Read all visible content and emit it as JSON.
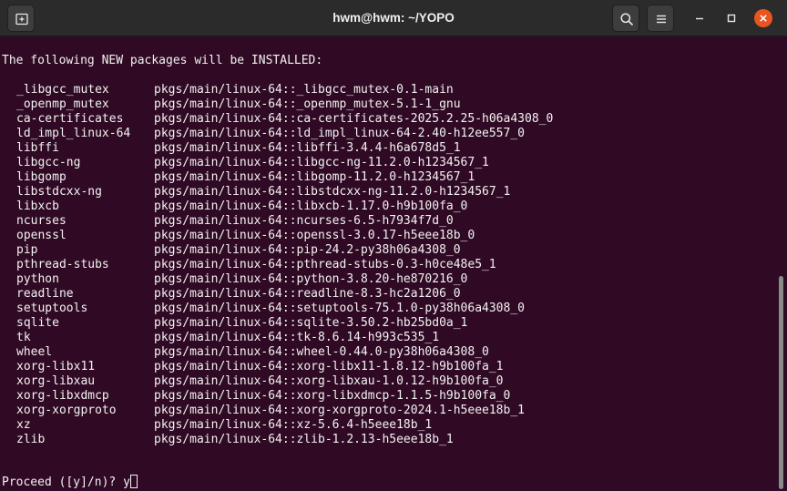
{
  "window": {
    "title": "hwm@hwm: ~/YOPO",
    "icons": {
      "new_tab": "new-tab-icon",
      "search": "search-icon",
      "menu": "hamburger-menu-icon",
      "minimize": "minimize-icon",
      "maximize": "maximize-icon",
      "close": "close-icon"
    },
    "colors": {
      "background": "#300a24",
      "titlebar": "#2b2b2b",
      "close": "#e95420",
      "text": "#f2f2f2"
    }
  },
  "terminal": {
    "header": "The following NEW packages will be INSTALLED:",
    "packages": [
      {
        "name": "_libgcc_mutex",
        "spec": "pkgs/main/linux-64::_libgcc_mutex-0.1-main"
      },
      {
        "name": "_openmp_mutex",
        "spec": "pkgs/main/linux-64::_openmp_mutex-5.1-1_gnu"
      },
      {
        "name": "ca-certificates",
        "spec": "pkgs/main/linux-64::ca-certificates-2025.2.25-h06a4308_0"
      },
      {
        "name": "ld_impl_linux-64",
        "spec": "pkgs/main/linux-64::ld_impl_linux-64-2.40-h12ee557_0"
      },
      {
        "name": "libffi",
        "spec": "pkgs/main/linux-64::libffi-3.4.4-h6a678d5_1"
      },
      {
        "name": "libgcc-ng",
        "spec": "pkgs/main/linux-64::libgcc-ng-11.2.0-h1234567_1"
      },
      {
        "name": "libgomp",
        "spec": "pkgs/main/linux-64::libgomp-11.2.0-h1234567_1"
      },
      {
        "name": "libstdcxx-ng",
        "spec": "pkgs/main/linux-64::libstdcxx-ng-11.2.0-h1234567_1"
      },
      {
        "name": "libxcb",
        "spec": "pkgs/main/linux-64::libxcb-1.17.0-h9b100fa_0"
      },
      {
        "name": "ncurses",
        "spec": "pkgs/main/linux-64::ncurses-6.5-h7934f7d_0"
      },
      {
        "name": "openssl",
        "spec": "pkgs/main/linux-64::openssl-3.0.17-h5eee18b_0"
      },
      {
        "name": "pip",
        "spec": "pkgs/main/linux-64::pip-24.2-py38h06a4308_0"
      },
      {
        "name": "pthread-stubs",
        "spec": "pkgs/main/linux-64::pthread-stubs-0.3-h0ce48e5_1"
      },
      {
        "name": "python",
        "spec": "pkgs/main/linux-64::python-3.8.20-he870216_0"
      },
      {
        "name": "readline",
        "spec": "pkgs/main/linux-64::readline-8.3-hc2a1206_0"
      },
      {
        "name": "setuptools",
        "spec": "pkgs/main/linux-64::setuptools-75.1.0-py38h06a4308_0"
      },
      {
        "name": "sqlite",
        "spec": "pkgs/main/linux-64::sqlite-3.50.2-hb25bd0a_1"
      },
      {
        "name": "tk",
        "spec": "pkgs/main/linux-64::tk-8.6.14-h993c535_1"
      },
      {
        "name": "wheel",
        "spec": "pkgs/main/linux-64::wheel-0.44.0-py38h06a4308_0"
      },
      {
        "name": "xorg-libx11",
        "spec": "pkgs/main/linux-64::xorg-libx11-1.8.12-h9b100fa_1"
      },
      {
        "name": "xorg-libxau",
        "spec": "pkgs/main/linux-64::xorg-libxau-1.0.12-h9b100fa_0"
      },
      {
        "name": "xorg-libxdmcp",
        "spec": "pkgs/main/linux-64::xorg-libxdmcp-1.1.5-h9b100fa_0"
      },
      {
        "name": "xorg-xorgproto",
        "spec": "pkgs/main/linux-64::xorg-xorgproto-2024.1-h5eee18b_1"
      },
      {
        "name": "xz",
        "spec": "pkgs/main/linux-64::xz-5.6.4-h5eee18b_1"
      },
      {
        "name": "zlib",
        "spec": "pkgs/main/linux-64::zlib-1.2.13-h5eee18b_1"
      }
    ],
    "prompt": "Proceed ([y]/n)? ",
    "input": "y"
  }
}
